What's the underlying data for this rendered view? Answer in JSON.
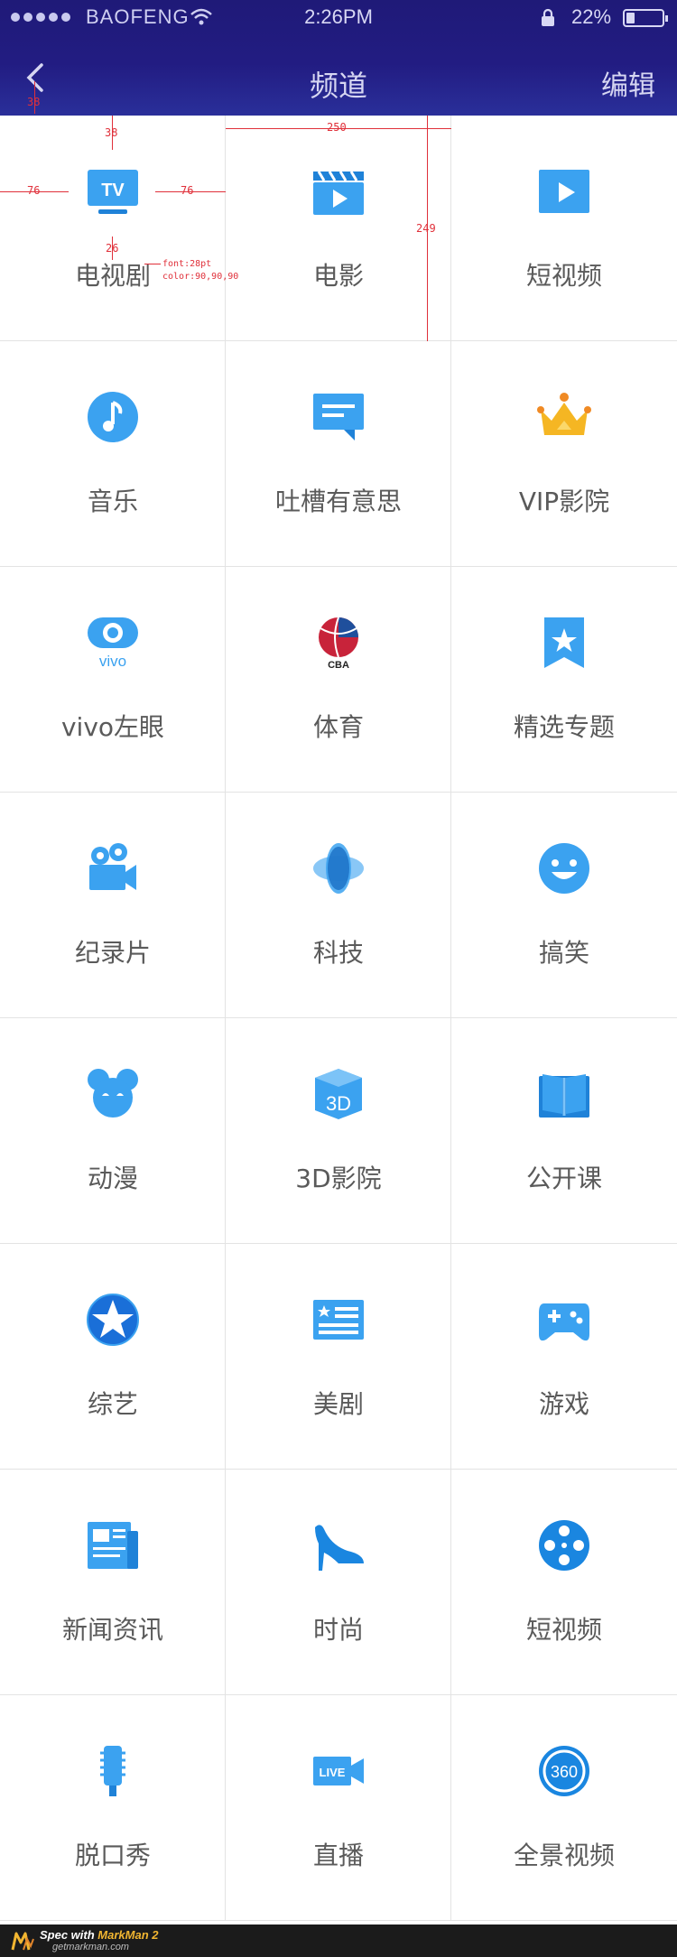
{
  "status_bar": {
    "carrier": "BAOFENG",
    "time": "2:26PM",
    "battery": "22%",
    "battery_level": 0.22
  },
  "nav": {
    "title": "频道",
    "edit_label": "编辑"
  },
  "channels": [
    {
      "label": "电视剧",
      "icon": "tv-icon"
    },
    {
      "label": "电影",
      "icon": "movie-clapper-icon"
    },
    {
      "label": "短视频",
      "icon": "play-icon"
    },
    {
      "label": "音乐",
      "icon": "music-note-icon"
    },
    {
      "label": "吐槽有意思",
      "icon": "comment-icon"
    },
    {
      "label": "VIP影院",
      "icon": "crown-icon"
    },
    {
      "label": "vivo左眼",
      "icon": "vivo-eye-icon"
    },
    {
      "label": "体育",
      "icon": "cba-basketball-icon"
    },
    {
      "label": "精选专题",
      "icon": "bookmark-star-icon"
    },
    {
      "label": "纪录片",
      "icon": "video-camera-icon"
    },
    {
      "label": "科技",
      "icon": "atom-icon"
    },
    {
      "label": "搞笑",
      "icon": "smiley-icon"
    },
    {
      "label": "动漫",
      "icon": "cartoon-mouse-icon"
    },
    {
      "label": "3D影院",
      "icon": "3d-cube-icon"
    },
    {
      "label": "公开课",
      "icon": "open-book-icon"
    },
    {
      "label": "综艺",
      "icon": "star-badge-icon"
    },
    {
      "label": "美剧",
      "icon": "us-flag-card-icon"
    },
    {
      "label": "游戏",
      "icon": "gamepad-icon"
    },
    {
      "label": "新闻资讯",
      "icon": "newspaper-icon"
    },
    {
      "label": "时尚",
      "icon": "high-heel-icon"
    },
    {
      "label": "短视频",
      "icon": "film-reel-icon"
    },
    {
      "label": "脱口秀",
      "icon": "microphone-icon"
    },
    {
      "label": "直播",
      "icon": "live-camera-icon"
    },
    {
      "label": "全景视频",
      "icon": "360-icon"
    }
  ],
  "spec": {
    "top_margin": "38",
    "icon_top": "38",
    "cell_width": "250",
    "side_left": "76",
    "side_right": "76",
    "cell_height": "249",
    "label_gap": "26",
    "font_note": "font:28pt",
    "color_note": "color:90,90,90"
  },
  "footer": {
    "prefix": "Spec with ",
    "brand": "MarkMan 2",
    "url": "getmarkman.com"
  },
  "colors": {
    "header": "#221c82",
    "icon_blue": "#3ba2f0",
    "crown_gold": "#f5b623",
    "label": "#5a5a5a",
    "divider": "#e3e3e3",
    "spec_red": "#e0303a"
  }
}
